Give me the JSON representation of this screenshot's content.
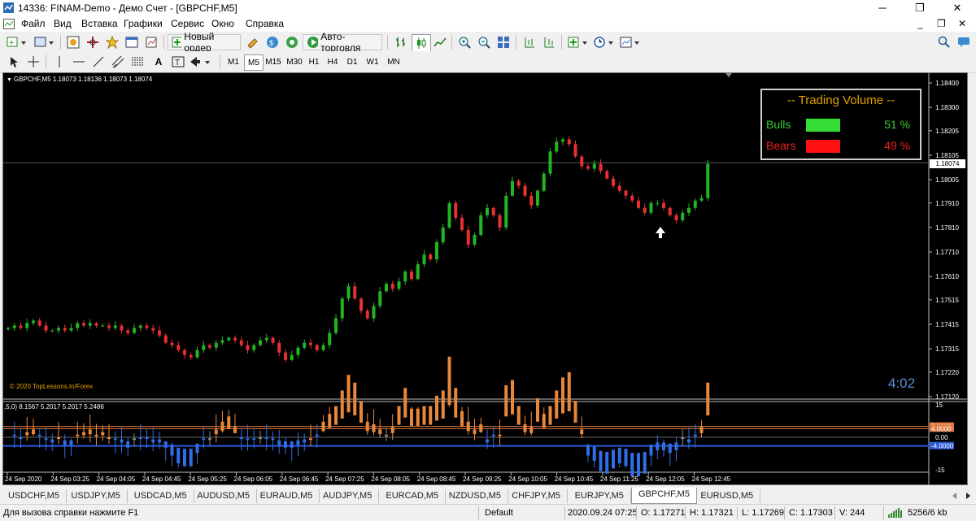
{
  "window": {
    "title": "14336: FINAM-Demo - Демо Счет - [GBPCHF,M5]",
    "buttons": [
      "─",
      "❐",
      "✕"
    ]
  },
  "menu": [
    "Файл",
    "Вид",
    "Вставка",
    "Графики",
    "Сервис",
    "Окно",
    "Справка"
  ],
  "toolbar": {
    "new_order": "Новый ордер",
    "auto_trading": "Авто-торговля"
  },
  "timeframes": [
    "M1",
    "M5",
    "M15",
    "M30",
    "H1",
    "H4",
    "D1",
    "W1",
    "MN"
  ],
  "active_timeframe": "M5",
  "chart": {
    "header": "GBPCHF,M5  1.18073 1.18136 1.18073 1.18074",
    "copyright": "© 2020 TopLessons.In/Forex",
    "timer": "4:02",
    "price_label": "1.18074",
    "subwindow_header": ",5,0) 8.1567 5.2017 5.2017 5.2486"
  },
  "panel": {
    "title": "-- Trading Volume --",
    "bulls_label": "Bulls",
    "bulls_pct": "51 %",
    "bears_label": "Bears",
    "bears_pct": "49 %",
    "bulls_color": "#33dd33",
    "bears_color": "#ff1111"
  },
  "chart_data": {
    "type": "candlestick",
    "symbol": "GBPCHF",
    "timeframe": "M5",
    "y_ticks": [
      "1.18400",
      "1.18300",
      "1.18205",
      "1.18105",
      "1.18005",
      "1.17910",
      "1.17810",
      "1.17710",
      "1.17610",
      "1.17515",
      "1.17415",
      "1.17315",
      "1.17220",
      "1.17120"
    ],
    "ylim": [
      1.1712,
      1.184
    ],
    "current_price": 1.18074,
    "x_ticks": [
      "24 Sep 2020",
      "24 Sep 03:25",
      "24 Sep 04:05",
      "24 Sep 04:45",
      "24 Sep 05:25",
      "24 Sep 06:05",
      "24 Sep 06:45",
      "24 Sep 07:25",
      "24 Sep 08:05",
      "24 Sep 08:45",
      "24 Sep 09:25",
      "24 Sep 10:05",
      "24 Sep 10:45",
      "24 Sep 11:25",
      "24 Sep 12:05",
      "24 Sep 12:45"
    ],
    "closes": [
      1.174,
      1.1741,
      1.174,
      1.1742,
      1.1743,
      1.1741,
      1.1739,
      1.1739,
      1.174,
      1.1739,
      1.174,
      1.1742,
      1.1741,
      1.1742,
      1.1741,
      1.1741,
      1.174,
      1.1741,
      1.1739,
      1.1738,
      1.174,
      1.1741,
      1.174,
      1.1739,
      1.1737,
      1.1734,
      1.1733,
      1.1731,
      1.1729,
      1.1728,
      1.1731,
      1.1733,
      1.1732,
      1.1734,
      1.1735,
      1.1736,
      1.1735,
      1.1733,
      1.1731,
      1.1733,
      1.1735,
      1.1736,
      1.1734,
      1.173,
      1.1727,
      1.1729,
      1.1732,
      1.1734,
      1.1733,
      1.1731,
      1.1733,
      1.1738,
      1.1744,
      1.1752,
      1.1757,
      1.1752,
      1.1747,
      1.1744,
      1.1749,
      1.1755,
      1.1758,
      1.1756,
      1.1759,
      1.1763,
      1.176,
      1.1766,
      1.177,
      1.1768,
      1.1775,
      1.1781,
      1.1791,
      1.1785,
      1.178,
      1.1774,
      1.1778,
      1.1786,
      1.1789,
      1.1786,
      1.1781,
      1.1794,
      1.18,
      1.1798,
      1.1794,
      1.179,
      1.1796,
      1.1803,
      1.1812,
      1.1816,
      1.1817,
      1.1815,
      1.181,
      1.1806,
      1.1805,
      1.1807,
      1.1804,
      1.1801,
      1.1798,
      1.1796,
      1.1794,
      1.1792,
      1.1789,
      1.1787,
      1.1791,
      1.1791,
      1.1789,
      1.1786,
      1.1784,
      1.1787,
      1.1789,
      1.1792,
      1.1793,
      1.1807
    ],
    "oscillator": {
      "levels": [
        5.0,
        4.0,
        0.0,
        -4.0
      ],
      "y_ticks": [
        "15",
        "0.00",
        "-15"
      ],
      "level_labels": [
        "5.0000",
        "4.0000",
        "-4.0000"
      ]
    }
  },
  "tabs": [
    "USDCHF,M5",
    "USDJPY,M5",
    "USDCAD,M5",
    "AUDUSD,M5",
    "EURAUD,M5",
    "AUDJPY,M5",
    "EURCAD,M5",
    "NZDUSD,M5",
    "CHFJPY,M5",
    "EURJPY,M5",
    "GBPCHF,M5",
    "EURUSD,M5"
  ],
  "active_tab": "GBPCHF,M5",
  "status": {
    "help": "Для вызова справки нажмите F1",
    "profile": "Default",
    "datetime": "2020.09.24 07:25",
    "open": "O: 1.17271",
    "high": "H: 1.17321",
    "low": "L: 1.17269",
    "close": "C: 1.17303",
    "volume": "V: 244",
    "traffic": "5256/6 kb"
  }
}
